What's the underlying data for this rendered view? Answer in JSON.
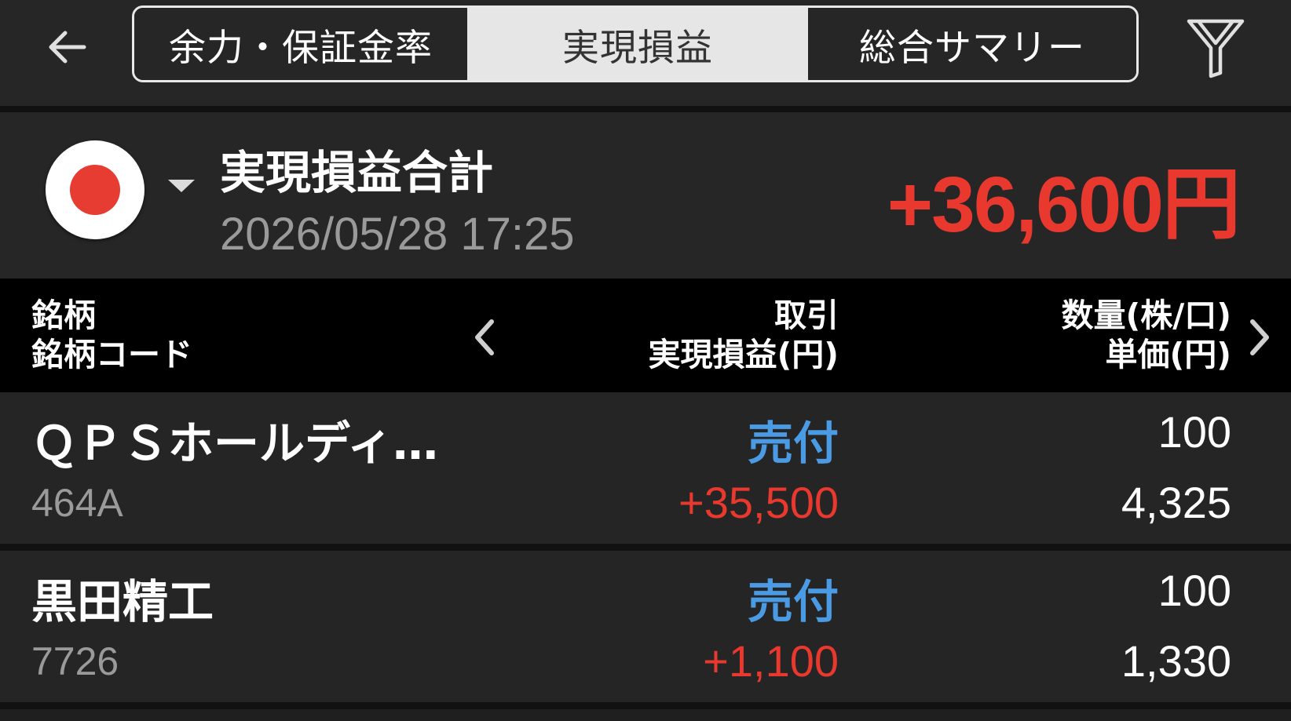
{
  "header": {
    "tabs": [
      {
        "label": "余力・保証金率",
        "active": false
      },
      {
        "label": "実現損益",
        "active": true
      },
      {
        "label": "総合サマリー",
        "active": false
      }
    ],
    "back_icon": "arrow-left-icon",
    "filter_icon": "filter-icon"
  },
  "summary": {
    "market_flag": "japan-flag-icon",
    "title": "実現損益合計",
    "datetime": "2026/05/28  17:25",
    "total": "+36,600円",
    "total_color": "#e9392f"
  },
  "table": {
    "col1_line1": "銘柄",
    "col1_line2": "銘柄コード",
    "col2_line1": "取引",
    "col2_line2": "実現損益(円)",
    "col3_line1": "数量(株/口)",
    "col3_line2": "単価(円)",
    "rows": [
      {
        "name": "ＱＰＳホールディ...",
        "code": "464A",
        "trade": "売付",
        "profit_loss": "+35,500",
        "quantity": "100",
        "unit_price": "4,325"
      },
      {
        "name": "黒田精工",
        "code": "7726",
        "trade": "売付",
        "profit_loss": "+1,100",
        "quantity": "100",
        "unit_price": "1,330"
      }
    ]
  },
  "colors": {
    "positive": "#e9392f",
    "sell": "#4a9be3",
    "background": "#1f1f1f",
    "header_bg": "#000000"
  }
}
